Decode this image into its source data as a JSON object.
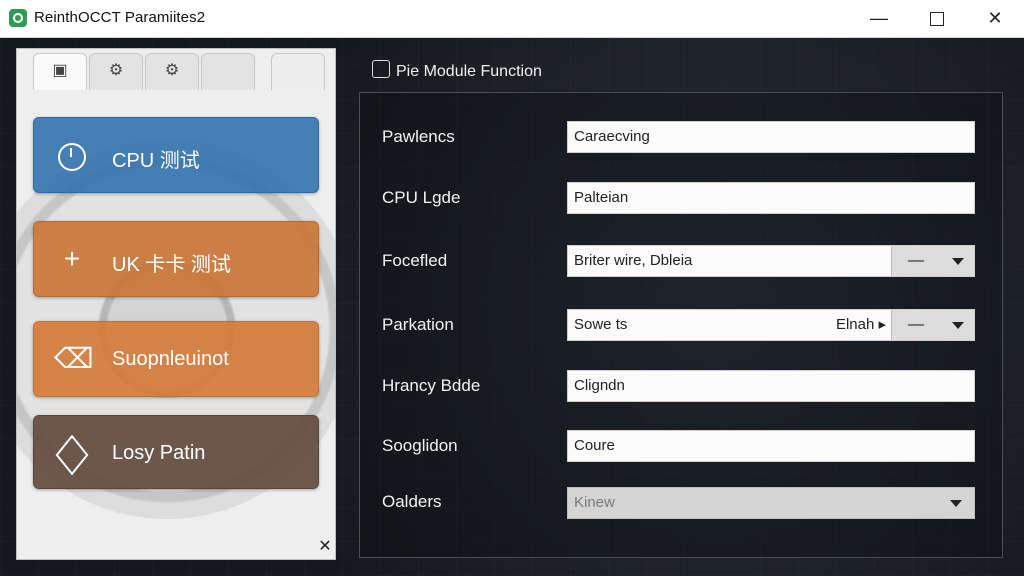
{
  "window": {
    "title": "ReinthOCCT Paramiites2",
    "minimize_glyph": "—",
    "close_glyph": "✕"
  },
  "sidebar": {
    "tab_icons": [
      "document-icon",
      "gear-icon",
      "gear-icon",
      "blank-tab",
      "blank-tab"
    ],
    "items": [
      {
        "label": "CPU 测试",
        "icon": "clock-icon",
        "color": "#2f70ac"
      },
      {
        "label": "UK 卡卡 测试",
        "icon": "plus-icon",
        "icon_glyph": "+",
        "color": "#ca7434"
      },
      {
        "label": "Suopnleuinot",
        "icon": "eraser-icon",
        "icon_glyph": "⌫",
        "color": "#d47a38"
      },
      {
        "label": "Losy Patin",
        "icon": "cube-icon",
        "color": "#5f483a"
      }
    ],
    "close_glyph": "✕"
  },
  "main": {
    "section_title": "Pie Module Function",
    "fields": [
      {
        "label": "Pawlencs",
        "value": "Caraecving",
        "type": "text"
      },
      {
        "label": "CPU Lgde",
        "value": "Palteian",
        "type": "text"
      },
      {
        "label": "Focefled",
        "value": "Briter wire, Dbleia",
        "type": "select",
        "button_text": "—"
      },
      {
        "label": "Parkation",
        "value": "Sowe ts",
        "right_value": "Elnah ▸",
        "type": "select",
        "button_text": "—"
      },
      {
        "label": "Hrancy Bdde",
        "value": "Cligndn",
        "type": "text"
      },
      {
        "label": "Sooglidon",
        "value": "Coure",
        "type": "text"
      },
      {
        "label": "Oalders",
        "value": "Kinew",
        "type": "select-disabled"
      }
    ]
  },
  "colors": {
    "accent_blue": "#2f70ac",
    "accent_orange": "#ca7434",
    "accent_brown": "#5f483a",
    "background_dark": "#15181c"
  }
}
